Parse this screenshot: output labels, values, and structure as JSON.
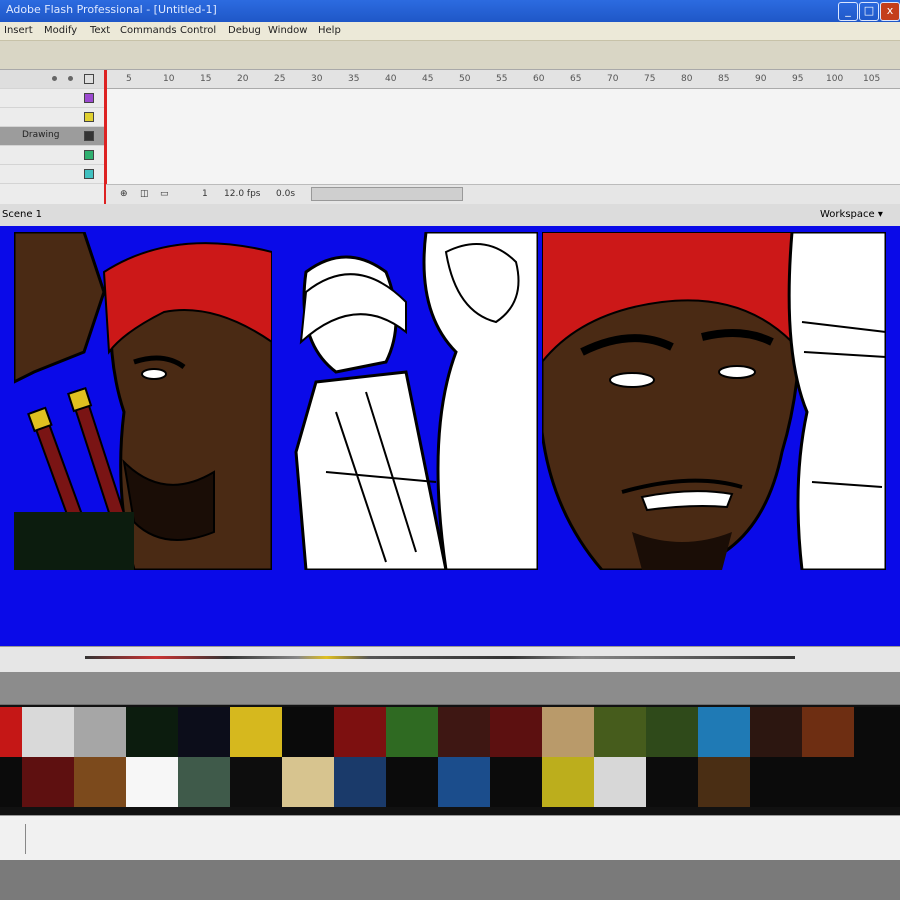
{
  "window": {
    "title": "Adobe Flash Professional - [Untitled-1]",
    "buttons": [
      "_",
      "□",
      "x"
    ]
  },
  "menu": {
    "items": [
      "Insert",
      "Modify",
      "Text",
      "Commands",
      "Control",
      "Debug",
      "Window",
      "Help"
    ]
  },
  "timeline": {
    "layers": [
      {
        "name": ""
      },
      {
        "name": ""
      },
      {
        "name": ""
      },
      {
        "name": "Drawing"
      },
      {
        "name": ""
      },
      {
        "name": ""
      }
    ],
    "ruler_marks": [
      "5",
      "10",
      "15",
      "20",
      "25",
      "30",
      "35",
      "40",
      "45",
      "50",
      "55",
      "60",
      "65",
      "70",
      "75",
      "80",
      "85",
      "90",
      "95",
      "100",
      "105"
    ],
    "status": {
      "frame": "1",
      "fps": "12.0 fps",
      "time": "0.0s"
    }
  },
  "editbar": {
    "scene_label": "Scene 1",
    "workspace_label": "Workspace ▾"
  },
  "swatches": {
    "row1": [
      "#c51716",
      "#d9d9d9",
      "#a6a6a6",
      "#0c1c0e",
      "#0c0d1a",
      "#d6b81e",
      "#0a0a0a",
      "#7d1010",
      "#2f6a22",
      "#3e1713",
      "#5c1010",
      "#b99a6a",
      "#465c1c",
      "#2f4a1a",
      "#1f7ab5",
      "#2c1610",
      "#6e2e12",
      "#0b0b0b"
    ],
    "row2": [
      "#0b0b0b",
      "#5e1010",
      "#7c4a1c",
      "#f7f7f7",
      "#3f5a4a",
      "#0d0d0d",
      "#d7c48f",
      "#1a3a6a",
      "#0b0b0b",
      "#1b4d8c",
      "#0b0b0b",
      "#bcae1c",
      "#d7d7d7",
      "#0c0c0c",
      "#4a2e14",
      "#0b0b0b",
      "#0b0b0b",
      "#0b0b0b"
    ]
  },
  "colors": {
    "stage": "#0a0ae8",
    "hair": "#cc1818",
    "skin": "#4a2a14"
  }
}
